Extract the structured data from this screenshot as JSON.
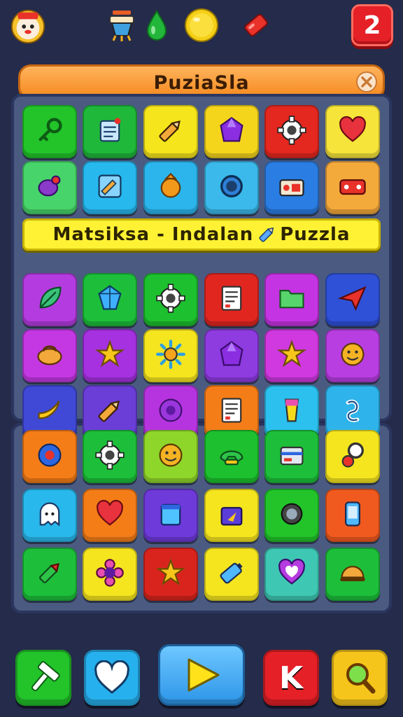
{
  "header": {
    "avatar_icon": "cat-face-icon",
    "items": [
      "cooking-pot-icon",
      "green-drop-icon",
      "gold-coin-icon",
      "red-eraser-icon"
    ],
    "level": "2"
  },
  "title_bar": {
    "title": "PuziaSla",
    "close_icon": "close-icon"
  },
  "banner": {
    "text": "Matsiksa - Indalan ",
    "text2": " Puzzla",
    "icon": "pencil-icon"
  },
  "board_top": {
    "rows": [
      [
        {
          "icon": "key-icon",
          "color": "#22c42a"
        },
        {
          "icon": "note-card-icon",
          "color": "#1fb83a"
        },
        {
          "icon": "pencil-icon",
          "color": "#f4e51c"
        },
        {
          "icon": "purple-gem-icon",
          "color": "#f5d51b"
        },
        {
          "icon": "gear-icon",
          "color": "#e4271f"
        },
        {
          "icon": "heart-icon",
          "color": "#f6e43a"
        }
      ],
      [
        {
          "icon": "fish-icon",
          "color": "#47d46a"
        },
        {
          "icon": "pencil-box-icon",
          "color": "#27b8ee"
        },
        {
          "icon": "orange-shield-icon",
          "color": "#2bb5ec"
        },
        {
          "icon": "ring-icon",
          "color": "#3ab9ea"
        },
        {
          "icon": "radio-icon",
          "color": "#2a7de2"
        },
        {
          "icon": "ticket-icon",
          "color": "#f4a93b"
        }
      ],
      [
        {
          "icon": "leaf-icon",
          "color": "#b43bdf"
        },
        {
          "icon": "blue-gem-icon",
          "color": "#1dbf3a"
        },
        {
          "icon": "gear-icon",
          "color": "#1dc02e"
        },
        {
          "icon": "document-icon",
          "color": "#e12620"
        },
        {
          "icon": "folder-icon",
          "color": "#c534e2"
        },
        {
          "icon": "paper-plane-icon",
          "color": "#2f51d8"
        }
      ],
      [
        {
          "icon": "purse-icon",
          "color": "#c438e3"
        },
        {
          "icon": "star-icon",
          "color": "#a531e0"
        },
        {
          "icon": "sun-icon",
          "color": "#f5e51f"
        },
        {
          "icon": "purple-gem-icon",
          "color": "#8e3be0"
        },
        {
          "icon": "star-icon",
          "color": "#cf39df"
        },
        {
          "icon": "smiley-icon",
          "color": "#b83ee2"
        }
      ],
      [
        {
          "icon": "banana-icon",
          "color": "#3f49d6"
        },
        {
          "icon": "pencil-icon",
          "color": "#6b3ed8"
        },
        {
          "icon": "purple-button-icon",
          "color": "#b634df"
        },
        {
          "icon": "document-icon",
          "color": "#f47d18"
        },
        {
          "icon": "glass-icon",
          "color": "#2bc0ee"
        },
        {
          "icon": "knot-icon",
          "color": "#2eb4ea"
        }
      ]
    ]
  },
  "board_bottom": {
    "rows": [
      [
        {
          "icon": "donut-icon",
          "color": "#f47d18"
        },
        {
          "icon": "gear-icon",
          "color": "#1dbf3a"
        },
        {
          "icon": "smiley-icon",
          "color": "#8fd62a"
        },
        {
          "icon": "phone-icon",
          "color": "#1dc02e"
        },
        {
          "icon": "wallet-icon",
          "color": "#1dbf3a"
        },
        {
          "icon": "magnifier-icon",
          "color": "#f4e51f"
        }
      ],
      [
        {
          "icon": "ghost-icon",
          "color": "#29b8ec"
        },
        {
          "icon": "heart-icon",
          "color": "#f47d18"
        },
        {
          "icon": "calendar-icon",
          "color": "#6e3ad9"
        },
        {
          "icon": "bag-icon",
          "color": "#f4e51f"
        },
        {
          "icon": "camera-icon",
          "color": "#22c42a"
        },
        {
          "icon": "phone-device-icon",
          "color": "#f15a1f"
        }
      ],
      [
        {
          "icon": "marker-icon",
          "color": "#1dbf3a"
        },
        {
          "icon": "flower-icon",
          "color": "#f4e51f"
        },
        {
          "icon": "star-icon",
          "color": "#d9241e"
        },
        {
          "icon": "battery-icon",
          "color": "#f4e51f"
        },
        {
          "icon": "heart-outline-icon",
          "color": "#3ec7b3"
        },
        {
          "icon": "helmet-icon",
          "color": "#1dbf3a"
        }
      ]
    ]
  },
  "bottom_bar": {
    "buttons": [
      {
        "icon": "hammer-icon",
        "color": "#22c42a"
      },
      {
        "icon": "heart-icon",
        "color": "#27b0ee"
      },
      {
        "icon": "play-icon",
        "color": "#3ea8f0"
      },
      {
        "label": "K",
        "color": "#e52027"
      },
      {
        "icon": "search-icon",
        "color": "#f5c51b"
      }
    ]
  }
}
